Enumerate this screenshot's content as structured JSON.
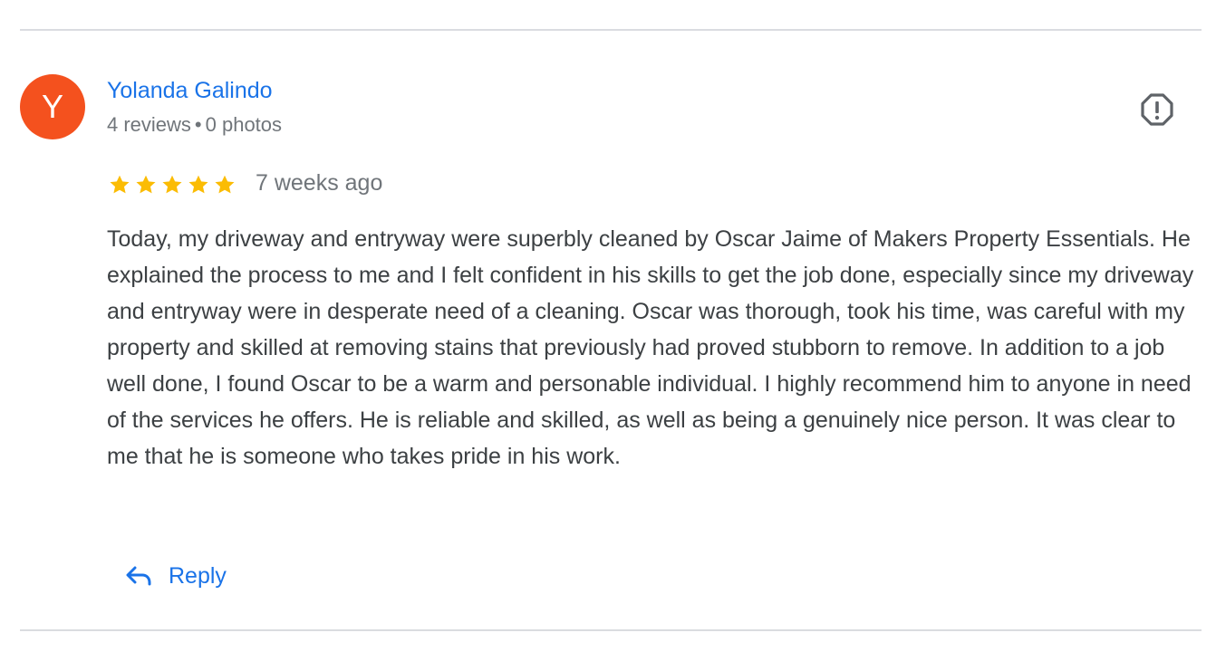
{
  "review": {
    "author": {
      "avatar_initial": "Y",
      "avatar_color": "#f4511e",
      "name": "Yolanda Galindo",
      "reviews_count": "4 reviews",
      "separator": "•",
      "photos_count": "0 photos"
    },
    "rating": 5,
    "rating_max": 5,
    "star_color": "#fbbc04",
    "time_ago": "7 weeks ago",
    "text": "Today, my driveway and entryway were superbly cleaned by Oscar Jaime of Makers Property Essentials. He explained the process to me and I felt confident in his skills to get the job done, especially since my driveway and entryway were in desperate need of a cleaning. Oscar was thorough, took his time, was careful with my property and skilled at removing stains that previously had proved stubborn to remove. In addition to a job well done, I found Oscar to be a warm and personable individual. I highly recommend him to anyone in need of the services he offers. He is reliable and skilled, as well as being a genuinely nice person. It was clear to me that he is someone who takes pride in his work.",
    "actions": {
      "reply_label": "Reply",
      "reply_icon": "reply-arrow-icon",
      "report_icon": "report-icon"
    }
  },
  "colors": {
    "link": "#1a73e8",
    "text": "#3c4043",
    "secondary_text": "#70757a",
    "divider": "#dadce0"
  }
}
